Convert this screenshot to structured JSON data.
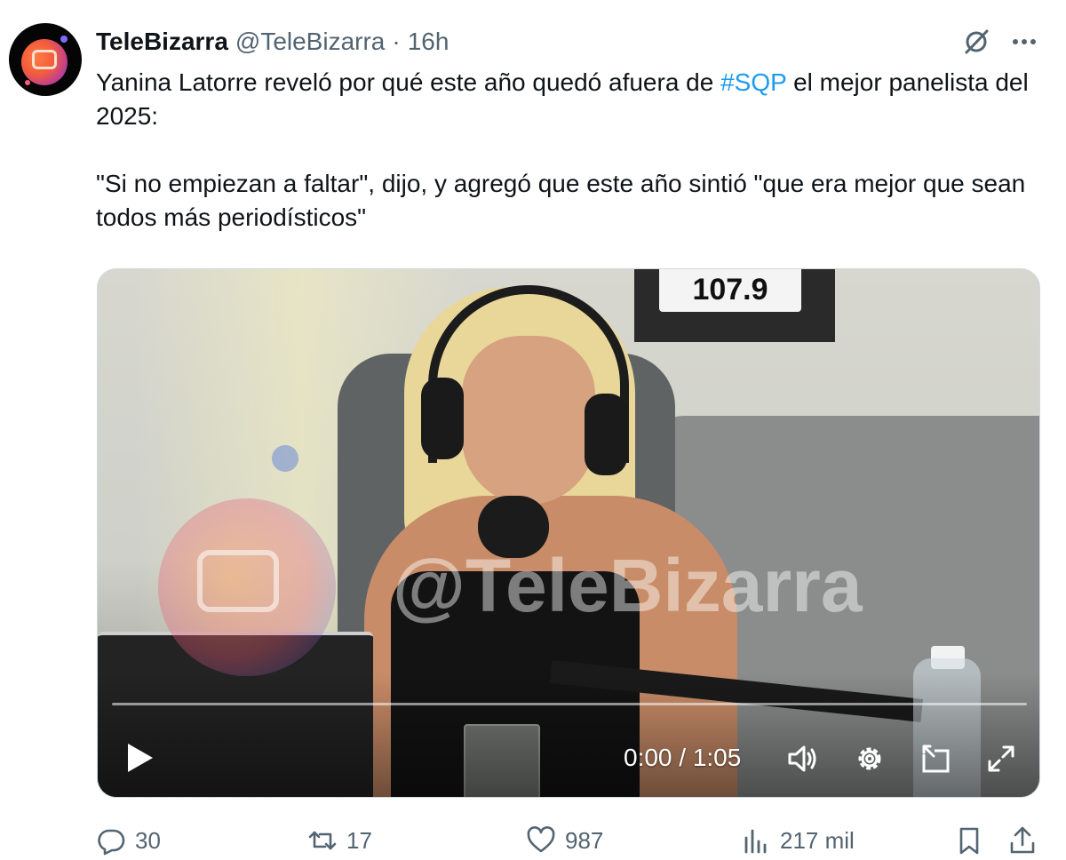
{
  "tweet": {
    "author_name": "TeleBizarra",
    "author_handle": "@TeleBizarra",
    "separator": "·",
    "time": "16h",
    "text_line1_before": "Yanina Latorre reveló por qué este año quedó afuera de ",
    "hashtag": "#SQP",
    "text_line1_after": " el mejor panelista del 2025:",
    "text_paragraph2": "\"Si no empiezan a faltar\", dijo, y agregó que este año sintió \"que era mejor que sean todos más periodísticos\""
  },
  "video": {
    "studio_sign": "107.9",
    "watermark": "@TeleBizarra",
    "current_time": "0:00",
    "duration": "1:05",
    "time_display": "0:00 / 1:05",
    "progress": 0.0,
    "controls": [
      "play-icon",
      "volume-icon",
      "settings-icon",
      "pip-icon",
      "fullscreen-icon"
    ]
  },
  "actions": {
    "replies": "30",
    "reposts": "17",
    "likes": "987",
    "views": "217 mil"
  },
  "colors": {
    "text_primary": "#0f1419",
    "text_secondary": "#536471",
    "link": "#1d9bf0"
  }
}
